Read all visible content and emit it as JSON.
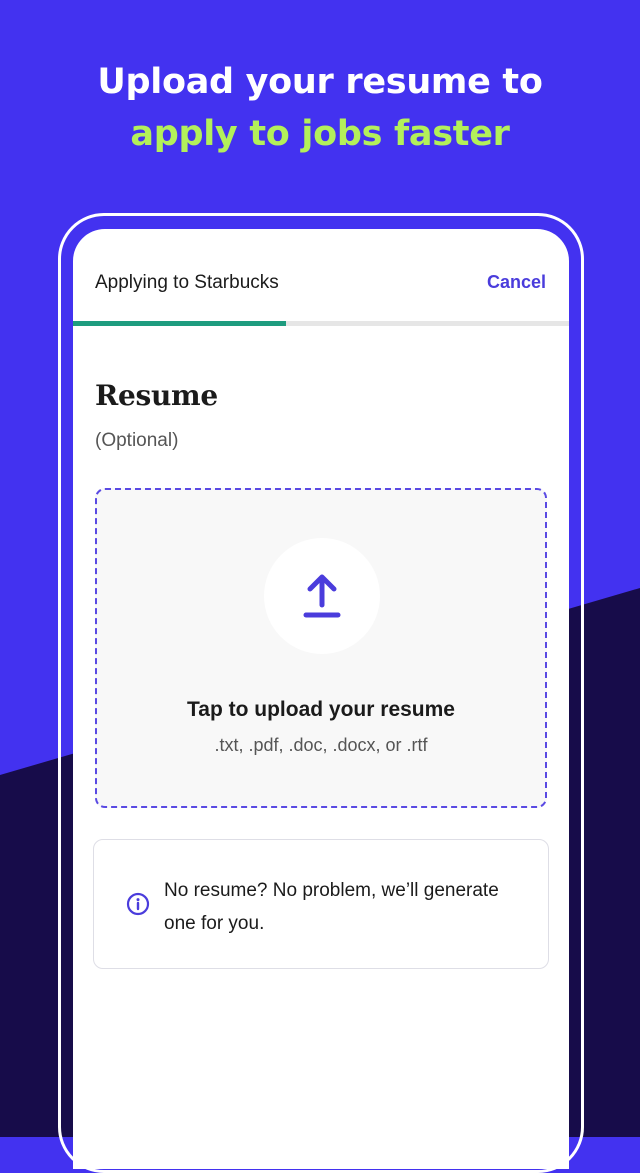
{
  "headline": {
    "line1": "Upload your resume to",
    "line2": "apply to jobs faster"
  },
  "app": {
    "title": "Applying to Starbucks",
    "cancel_label": "Cancel",
    "progress_fraction": 0.43
  },
  "resume_section": {
    "title": "Resume",
    "subtitle": "(Optional)"
  },
  "upload": {
    "icon": "upload-arrow-icon",
    "title": "Tap to upload your resume",
    "formats": ".txt, .pdf, .doc, .docx, or .rtf"
  },
  "info": {
    "icon": "info-icon",
    "message": "No resume? No problem, we’ll generate one for you."
  },
  "colors": {
    "background_primary": "#4332f0",
    "background_dark": "#170c4a",
    "headline_accent": "#b3f05a",
    "brand_accent": "#4a3cdc",
    "progress": "#1e9c7f"
  }
}
